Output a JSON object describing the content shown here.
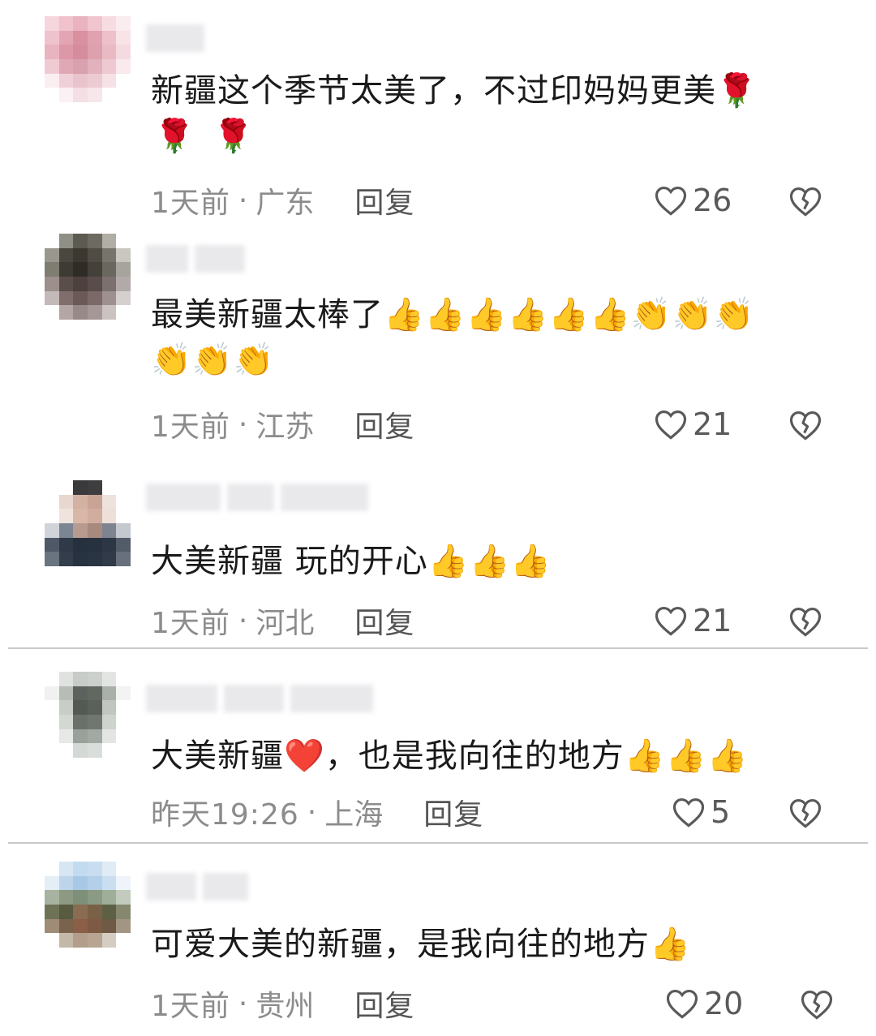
{
  "comments": [
    {
      "text": "新疆这个季节太美了，不过印妈妈更美",
      "emoji_icons": [
        "rose-emoji",
        "rose-emoji",
        "rose-emoji"
      ],
      "time": "1天前",
      "location": "广东",
      "reply": "回复",
      "likes": "26"
    },
    {
      "text": "最美新疆太棒了",
      "emoji_icons": [
        "thumbs-up-emoji",
        "thumbs-up-emoji",
        "thumbs-up-emoji",
        "thumbs-up-emoji",
        "thumbs-up-emoji",
        "thumbs-up-emoji",
        "clapping-hands-emoji",
        "clapping-hands-emoji",
        "clapping-hands-emoji",
        "clapping-hands-emoji",
        "clapping-hands-emoji",
        "clapping-hands-emoji"
      ],
      "time": "1天前",
      "location": "江苏",
      "reply": "回复",
      "likes": "21"
    },
    {
      "text": "大美新疆 玩的开心",
      "emoji_icons": [
        "thumbs-up-emoji",
        "thumbs-up-emoji",
        "thumbs-up-emoji"
      ],
      "time": "1天前",
      "location": "河北",
      "reply": "回复",
      "likes": "21"
    },
    {
      "text_before": "大美新疆",
      "text_after": "，也是我向往的地方",
      "emoji_icons": [
        "red-heart-emoji",
        "thumbs-up-emoji",
        "thumbs-up-emoji",
        "thumbs-up-emoji"
      ],
      "time": "昨天19:26",
      "location": "上海",
      "reply": "回复",
      "likes": "5"
    },
    {
      "text": "可爱大美的新疆，是我向往的地方",
      "emoji_icons": [
        "thumbs-up-emoji"
      ],
      "time": "1天前",
      "location": "贵州",
      "reply": "回复",
      "likes": "20"
    }
  ],
  "separator": "·",
  "emoji_glyphs": {
    "rose": "🌹",
    "thumbs_up": "👍",
    "clap": "👏",
    "heart": "❤️"
  },
  "colors": {
    "text": "#1a1a1a",
    "meta": "#8c8c8c",
    "divider": "#c9c9cc"
  }
}
